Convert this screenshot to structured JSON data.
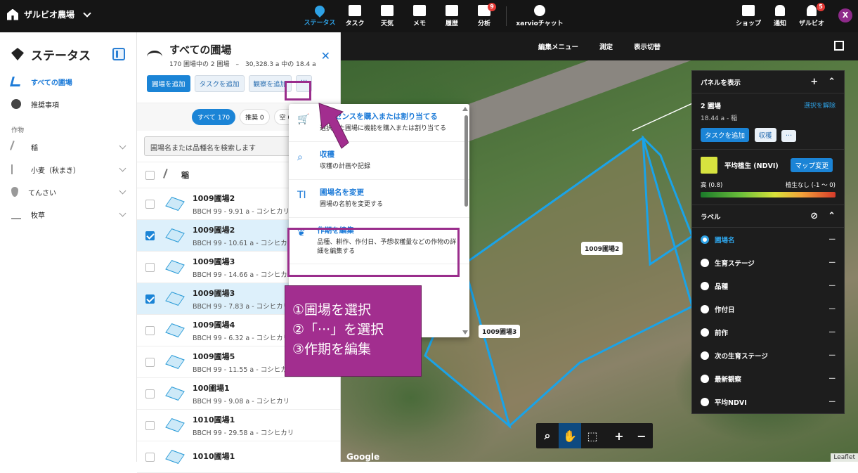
{
  "topbar": {
    "brand": "ザルビオ農場",
    "nav": [
      {
        "label": "ステータス",
        "icon": "map-pin-icon",
        "active": true
      },
      {
        "label": "タスク",
        "icon": "calendar-icon"
      },
      {
        "label": "天気",
        "icon": "weather-icon"
      },
      {
        "label": "メモ",
        "icon": "note-icon"
      },
      {
        "label": "履歴",
        "icon": "history-icon"
      },
      {
        "label": "分析",
        "icon": "analysis-icon",
        "badge": "9"
      },
      {
        "label": "xarvioチャット",
        "icon": "chat-icon"
      }
    ],
    "right": [
      {
        "label": "ショップ",
        "icon": "cart-icon"
      },
      {
        "label": "通知",
        "icon": "bell-icon"
      },
      {
        "label": "ザルビオ",
        "icon": "user-icon",
        "badge": "5"
      }
    ],
    "avatar": "X"
  },
  "sidebar": {
    "title": "ステータス",
    "links": [
      "すべての圃場",
      "推奨事項"
    ],
    "section": "作物",
    "crops": [
      "稲",
      "小麦（秋まき）",
      "てんさい",
      "牧草"
    ]
  },
  "list": {
    "title": "すべての圃場",
    "subtitle": "170 圃場中の 2 圃場　–　30,328.3 a 中の 18.4 a",
    "buttons": [
      "圃場を追加",
      "タスクを追加",
      "観察を追加",
      "···"
    ],
    "filters": [
      "すべて 170",
      "推奨 0",
      "空 0"
    ],
    "search_placeholder": "圃場名または品種名を検索します",
    "group": "稲",
    "rows": [
      {
        "name": "1009圃場2",
        "meta": "BBCH 99 - 9.91 a - コシヒカリ",
        "selected": false
      },
      {
        "name": "1009圃場2",
        "meta": "BBCH 99 - 10.61 a - コシヒカリ",
        "selected": true
      },
      {
        "name": "1009圃場3",
        "meta": "BBCH 99 - 14.66 a - コシヒカリ",
        "selected": false
      },
      {
        "name": "1009圃場3",
        "meta": "BBCH 99 - 7.83 a - コシヒカリ",
        "selected": true
      },
      {
        "name": "1009圃場4",
        "meta": "BBCH 99 - 6.32 a - コシヒカリ",
        "selected": false
      },
      {
        "name": "1009圃場5",
        "meta": "BBCH 99 - 11.55 a - コシヒカリ",
        "selected": false
      },
      {
        "name": "100圃場1",
        "meta": "BBCH 99 - 9.08 a - コシヒカリ",
        "selected": false
      },
      {
        "name": "1010圃場1",
        "meta": "BBCH 99 - 29.58 a - コシヒカリ",
        "selected": false
      },
      {
        "name": "1010圃場1",
        "meta": "",
        "selected": false
      }
    ]
  },
  "dropdown": {
    "items": [
      {
        "title": "ライセンスを購入または割り当てる",
        "desc": "選択した圃場に機能を購入または割り当てる",
        "icon": "cart-icon"
      },
      {
        "title": "収穫",
        "desc": "収穫の計画や記録",
        "icon": "harvest-icon"
      },
      {
        "title": "圃場名を変更",
        "desc": "圃場の名前を変更する",
        "icon": "rename-icon"
      },
      {
        "title": "作期を編集",
        "desc": "品種、耕作、作付日、予想収穫量などの作物の詳細を編集する",
        "icon": "sprout-icon"
      }
    ]
  },
  "callout": {
    "lines": [
      "①圃場を選択",
      "②「···」を選択",
      "③作期を編集"
    ]
  },
  "map": {
    "toolbar": [
      "編集メニュー",
      "測定",
      "表示切替"
    ],
    "labels": [
      "1009圃場2",
      "1009圃場3"
    ],
    "tools": [
      "search",
      "hand",
      "select",
      "+",
      "−"
    ],
    "google": "Google",
    "leaflet": "Leaflet"
  },
  "panel": {
    "title": "パネルを表示",
    "selection_title": "2 圃場",
    "selection_sub": "18.44 a - 稲",
    "clear": "選択を解除",
    "buttons": [
      "タスクを追加",
      "収穫",
      "···"
    ],
    "ndvi_label": "平均植生 (NDVI)",
    "ndvi_button": "マップ変更",
    "ndvi_high": "高 (0.8)",
    "ndvi_low": "植生なし (-1 ～ 0)",
    "labels_title": "ラベル",
    "labels": [
      {
        "name": "圃場名",
        "on": true
      },
      {
        "name": "生育ステージ",
        "on": false
      },
      {
        "name": "品種",
        "on": false
      },
      {
        "name": "作付日",
        "on": false
      },
      {
        "name": "前作",
        "on": false
      },
      {
        "name": "次の生育ステージ",
        "on": false
      },
      {
        "name": "最新観察",
        "on": false
      },
      {
        "name": "平均NDVI",
        "on": false
      }
    ]
  }
}
